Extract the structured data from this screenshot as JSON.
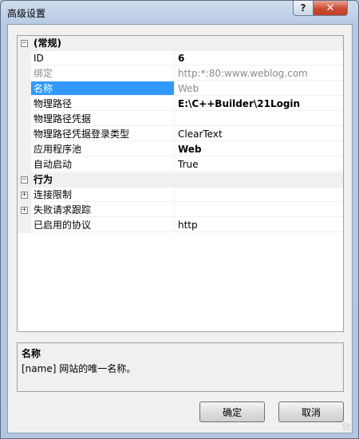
{
  "window": {
    "title": "高级设置",
    "help_label": "?",
    "close_label": "✕"
  },
  "grid": {
    "rows": [
      {
        "kind": "category",
        "name": "(常规)",
        "toggle": "−"
      },
      {
        "kind": "prop",
        "name": "ID",
        "value": "6",
        "value_style": "bold"
      },
      {
        "kind": "prop",
        "name": "绑定",
        "value": "http:*:80:www.weblog.com",
        "style": "grey"
      },
      {
        "kind": "prop",
        "name": "名称",
        "value": "Web",
        "style": "grey",
        "selected": true
      },
      {
        "kind": "prop",
        "name": "物理路径",
        "value": "E:\\C++Builder\\21Login",
        "value_style": "bold"
      },
      {
        "kind": "prop",
        "name": "物理路径凭据",
        "value": ""
      },
      {
        "kind": "prop",
        "name": "物理路径凭据登录类型",
        "value": "ClearText"
      },
      {
        "kind": "prop",
        "name": "应用程序池",
        "value": "Web",
        "value_style": "bold"
      },
      {
        "kind": "prop",
        "name": "自动启动",
        "value": "True"
      },
      {
        "kind": "category",
        "name": "行为",
        "toggle": "−"
      },
      {
        "kind": "prop",
        "name": "连接限制",
        "value": "",
        "toggle": "+"
      },
      {
        "kind": "prop",
        "name": "失败请求跟踪",
        "value": "",
        "toggle": "+"
      },
      {
        "kind": "prop",
        "name": "已启用的协议",
        "value": "http"
      }
    ]
  },
  "description": {
    "title": "名称",
    "text": "[name] 网站的唯一名称。"
  },
  "buttons": {
    "ok": "确定",
    "cancel": "取消"
  }
}
